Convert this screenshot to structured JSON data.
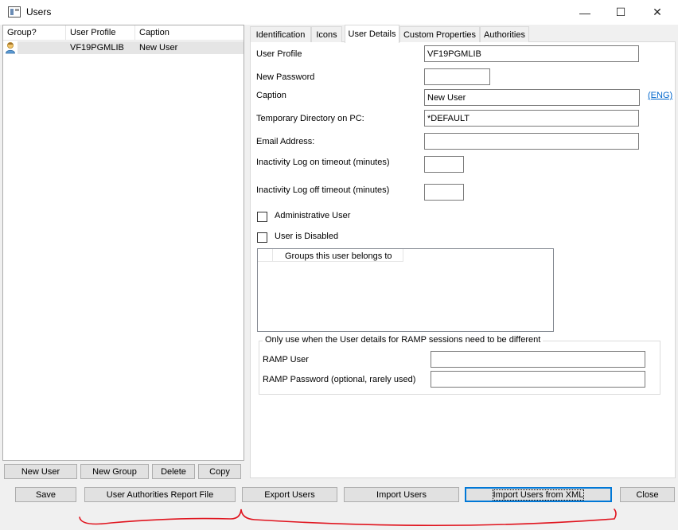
{
  "window": {
    "title": "Users",
    "minimize": "—",
    "maximize": "☐",
    "close": "✕"
  },
  "list": {
    "columns": [
      "Group?",
      "User Profile",
      "Caption"
    ],
    "rows": [
      {
        "profile": "VF19PGMLIB",
        "caption": "New User"
      }
    ]
  },
  "left_buttons": {
    "new_user": "New User",
    "new_group": "New Group",
    "delete": "Delete",
    "copy": "Copy"
  },
  "tabs": [
    "Identification",
    "Icons",
    "User Details",
    "Custom Properties",
    "Authorities"
  ],
  "active_tab": "User Details",
  "form": {
    "user_profile_label": "User Profile",
    "user_profile_value": "VF19PGMLIB",
    "new_password_label": "New Password",
    "new_password_value": "",
    "caption_label": "Caption",
    "caption_value": "New User",
    "lang_link": "(ENG)",
    "temp_dir_label": "Temporary Directory on PC:",
    "temp_dir_value": "*DEFAULT",
    "email_label": "Email Address:",
    "email_value": "",
    "logon_timeout_label": "Inactivity Log on timeout (minutes)",
    "logon_timeout_value": "",
    "logoff_timeout_label": "Inactivity Log off timeout (minutes)",
    "logoff_timeout_value": "",
    "admin_label": "Administrative User",
    "admin_checked": false,
    "disabled_label": "User is Disabled",
    "disabled_checked": false,
    "groups_header": "Groups this user belongs to",
    "ramp_legend": "Only use when the User details for RAMP sessions need to be different",
    "ramp_user_label": "RAMP User",
    "ramp_user_value": "",
    "ramp_password_label": "RAMP Password (optional, rarely used)",
    "ramp_password_value": ""
  },
  "bottom_buttons": {
    "save": "Save",
    "report": "User Authorities Report File",
    "export": "Export Users",
    "import": "Import Users",
    "import_xml": "Import Users from XML",
    "close": "Close"
  },
  "colors": {
    "accent": "#0078d7",
    "link": "#0066cc",
    "annotation": "#e0141e",
    "selection": "#e5e5e5"
  }
}
